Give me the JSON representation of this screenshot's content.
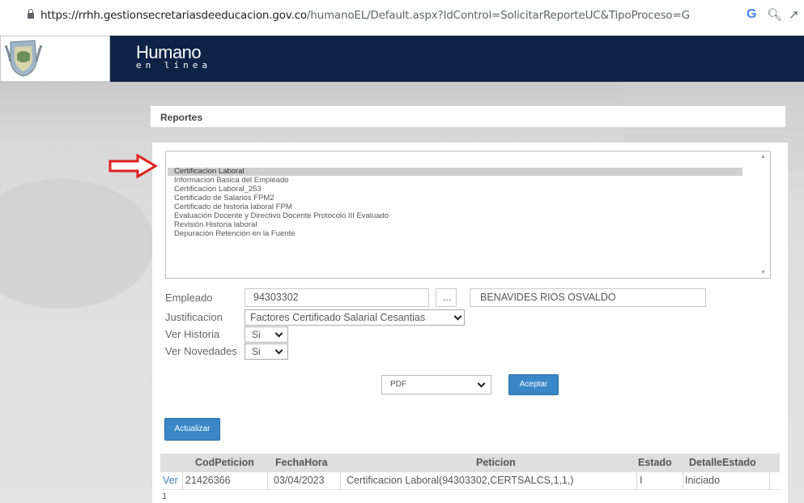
{
  "browser": {
    "url_domain": "https://rrhh.gestionsecretariasdeeducacion.gov.co",
    "url_path": "/humanoEL/Default.aspx?IdControl=SolicitarReporteUC&TipoProceso=G",
    "google_icon": "G",
    "zoom_icon": "zoom-icon",
    "share_icon": "share-icon"
  },
  "header": {
    "brand": "Humano",
    "brand_sub": "en línea"
  },
  "panel": {
    "title": "Reportes"
  },
  "reports": [
    "Certificacion Laboral",
    "Informacion Basica del Empleado",
    "Certificacion Laboral_253",
    "Certificado de Salarios FPM2",
    "Certificado de historia laboral FPM",
    "Evaluación Docente y Directivo Docente Protocolo III Evaluado",
    "Revisión Historia laboral",
    "Depuración Retención en la Fuente"
  ],
  "form": {
    "empleado_label": "Empleado",
    "empleado_id": "94303302",
    "lookup_label": "...",
    "empleado_name": "BENAVIDES RIOS OSVALDO",
    "justificacion_label": "Justificacion",
    "justificacion_value": "Factores Certificado Salarial Cesantias",
    "ver_historia_label": "Ver Historia",
    "ver_historia_value": "Si",
    "ver_novedades_label": "Ver Novedades",
    "ver_novedades_value": "Si",
    "format_value": "PDF",
    "aceptar_label": "Aceptar",
    "actualizar_label": "Actualizar"
  },
  "grid": {
    "headers": [
      "CodPeticion",
      "FechaHora",
      "Peticion",
      "Estado",
      "DetalleEstado"
    ],
    "rows": [
      {
        "link": "Ver",
        "cod": "21426366",
        "fecha": "03/04/2023",
        "peticion": "Certificacion Laboral(94303302,CERTSALCS,1,1,)",
        "estado": "I",
        "detalle": "Iniciado"
      }
    ],
    "pager": "1"
  },
  "colors": {
    "header_bg": "#0d2347",
    "button": "#3a87c7",
    "arrow": "#e02020"
  }
}
